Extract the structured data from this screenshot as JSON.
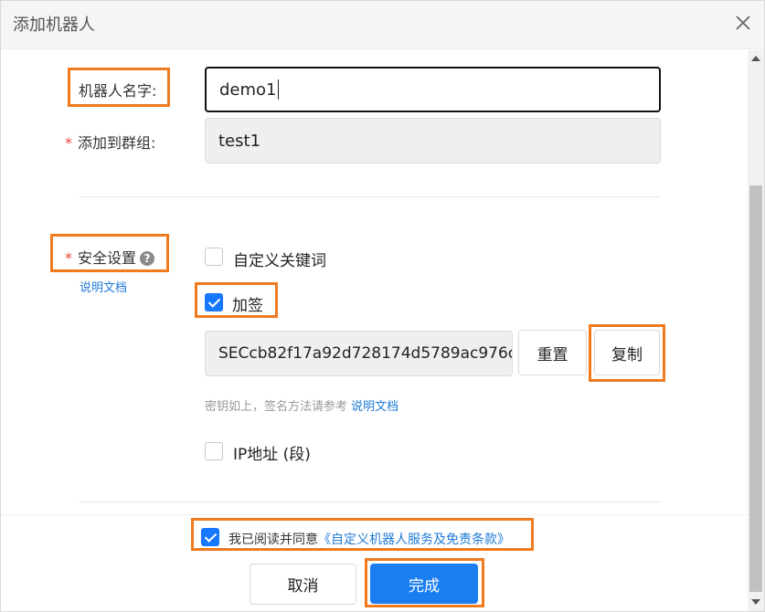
{
  "dialog": {
    "title": "添加机器人"
  },
  "form": {
    "robot_name_label": "机器人名字:",
    "robot_name_value": "demo1",
    "group_required_mark": "*",
    "group_label": "添加到群组:",
    "group_value": "test1",
    "security_required_mark": "*",
    "security_label": "安全设置",
    "security_help_glyph": "?",
    "security_doc_link": "说明文档",
    "options": {
      "custom_keyword_label": "自定义关键词",
      "custom_keyword_checked": false,
      "sign_label": "加签",
      "sign_checked": true,
      "ip_label": "IP地址 (段)",
      "ip_checked": false
    },
    "secret_value": "SECcb82f17a92d728174d5789ac976c",
    "reset_button": "重置",
    "copy_button": "复制",
    "hint_text": "密钥如上，签名方法请参考",
    "hint_link": "说明文档"
  },
  "footer": {
    "agree_checked": true,
    "agree_text": "我已阅读并同意",
    "agree_link": "《自定义机器人服务及免责条款》",
    "cancel_button": "取消",
    "finish_button": "完成"
  },
  "colors": {
    "highlight": "#f07a1e",
    "primary": "#1a7ef0",
    "link": "#1f7ad6",
    "required": "#e8453c"
  }
}
